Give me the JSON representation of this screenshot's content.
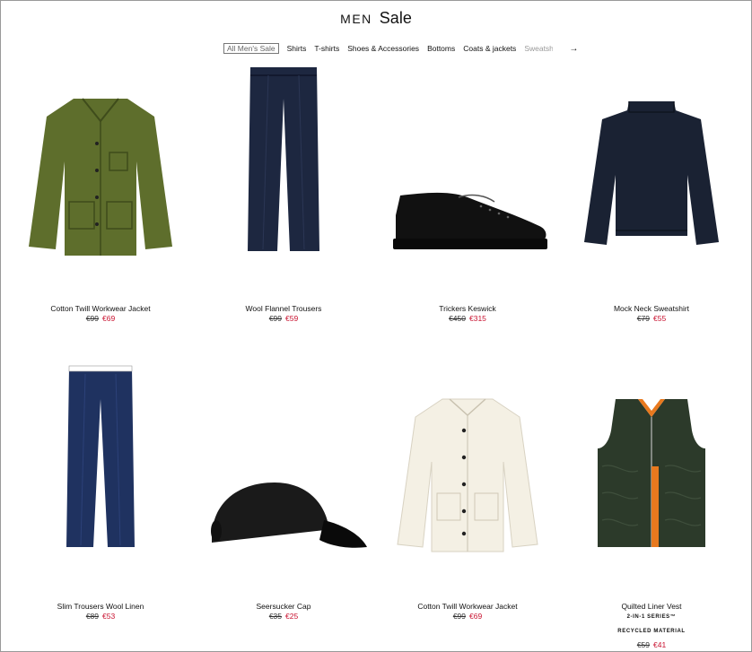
{
  "header": {
    "section": "MEN",
    "title": "Sale"
  },
  "nav": {
    "tabs": [
      "All Men's Sale",
      "Shirts",
      "T-shirts",
      "Shoes & Accessories",
      "Bottoms",
      "Coats & jackets",
      "Sweatshirts"
    ],
    "next_icon": "arrow-right-icon"
  },
  "products": [
    {
      "name": "Cotton Twill Workwear Jacket",
      "old_price": "€99",
      "new_price": "€69",
      "color": "#5e6e2c",
      "icon": "jacket"
    },
    {
      "name": "Wool Flannel Trousers",
      "old_price": "€99",
      "new_price": "€59",
      "color": "#1d2740",
      "icon": "trousers"
    },
    {
      "name": "Trickers Keswick",
      "old_price": "€450",
      "new_price": "€315",
      "color": "#111111",
      "icon": "shoe"
    },
    {
      "name": "Mock Neck Sweatshirt",
      "old_price": "€79",
      "new_price": "€55",
      "color": "#1a2233",
      "icon": "sweatshirt"
    },
    {
      "name": "Slim Trousers Wool Linen",
      "old_price": "€89",
      "new_price": "€53",
      "color": "#1f3260",
      "icon": "trousers"
    },
    {
      "name": "Seersucker Cap",
      "old_price": "€35",
      "new_price": "€25",
      "color": "#1a1a1a",
      "icon": "cap"
    },
    {
      "name": "Cotton Twill Workwear Jacket",
      "old_price": "€99",
      "new_price": "€69",
      "color": "#f4f0e4",
      "icon": "jacket"
    },
    {
      "name": "Quilted Liner Vest",
      "old_price": "€59",
      "new_price": "€41",
      "color": "#2c3a2a",
      "icon": "vest",
      "series": "2-IN-1 SERIES™",
      "tag": "RECYCLED MATERIAL"
    }
  ],
  "colors": {
    "sale_price": "#c8102e"
  }
}
